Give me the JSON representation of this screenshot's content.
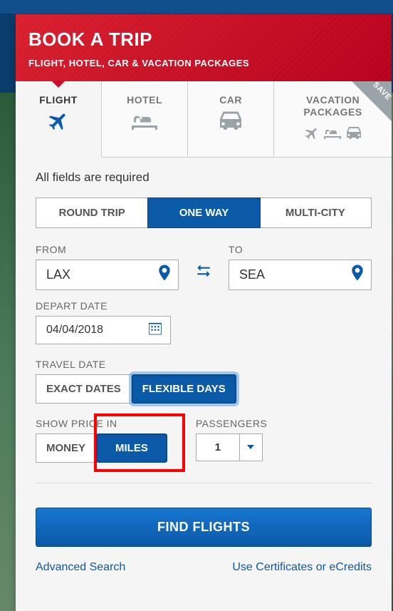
{
  "header": {
    "title": "BOOK A TRIP",
    "subtitle": "FLIGHT, HOTEL, CAR & VACATION PACKAGES"
  },
  "tabs": {
    "flight": "FLIGHT",
    "hotel": "HOTEL",
    "car": "CAR",
    "vacation1": "VACATION",
    "vacation2": "PACKAGES",
    "save_tag": "SAVE"
  },
  "required_text": "All fields are required",
  "trip_type": {
    "round": "ROUND TRIP",
    "oneway": "ONE WAY",
    "multi": "MULTI-CITY"
  },
  "from": {
    "label": "FROM",
    "value": "LAX"
  },
  "to": {
    "label": "TO",
    "value": "SEA"
  },
  "depart": {
    "label": "DEPART DATE",
    "value": "04/04/2018"
  },
  "travel_date": {
    "label": "TRAVEL DATE",
    "exact": "EXACT DATES",
    "flexible": "FLEXIBLE DAYS"
  },
  "price": {
    "label": "SHOW PRICE IN",
    "money": "MONEY",
    "miles": "MILES"
  },
  "passengers": {
    "label": "PASSENGERS",
    "value": "1"
  },
  "find_button": "FIND FLIGHTS",
  "links": {
    "advanced": "Advanced Search",
    "ecredits": "Use Certificates or eCredits"
  }
}
